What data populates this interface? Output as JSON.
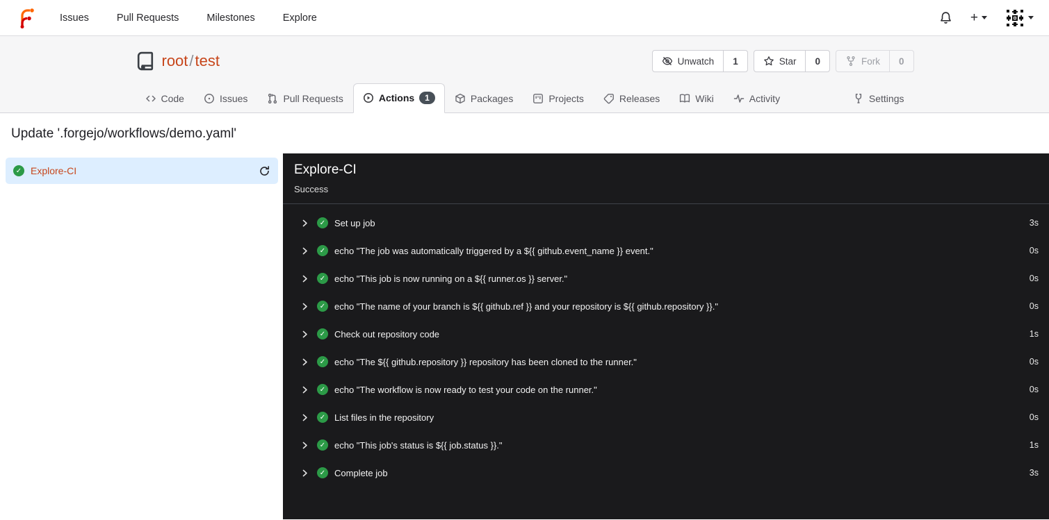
{
  "navbar": {
    "links": [
      {
        "label": "Issues"
      },
      {
        "label": "Pull Requests"
      },
      {
        "label": "Milestones"
      },
      {
        "label": "Explore"
      }
    ]
  },
  "repo_header": {
    "owner": "root",
    "separator": "/",
    "name": "test",
    "watch": {
      "label": "Unwatch",
      "count": "1"
    },
    "star": {
      "label": "Star",
      "count": "0"
    },
    "fork": {
      "label": "Fork",
      "count": "0"
    }
  },
  "tabs": [
    {
      "label": "Code"
    },
    {
      "label": "Issues"
    },
    {
      "label": "Pull Requests"
    },
    {
      "label": "Actions",
      "badge": "1",
      "active": true
    },
    {
      "label": "Packages"
    },
    {
      "label": "Projects"
    },
    {
      "label": "Releases"
    },
    {
      "label": "Wiki"
    },
    {
      "label": "Activity"
    },
    {
      "label": "Settings"
    }
  ],
  "page": {
    "title": "Update '.forgejo/workflows/demo.yaml'"
  },
  "sidebar": {
    "jobs": [
      {
        "name": "Explore-CI",
        "status": "success"
      }
    ]
  },
  "job_panel": {
    "title": "Explore-CI",
    "status_text": "Success",
    "steps": [
      {
        "name": "Set up job",
        "duration": "3s"
      },
      {
        "name": "echo \"The job was automatically triggered by a ${{ github.event_name }} event.\"",
        "duration": "0s"
      },
      {
        "name": "echo \"This job is now running on a ${{ runner.os }} server.\"",
        "duration": "0s"
      },
      {
        "name": "echo \"The name of your branch is ${{ github.ref }} and your repository is ${{ github.repository }}.\"",
        "duration": "0s"
      },
      {
        "name": "Check out repository code",
        "duration": "1s"
      },
      {
        "name": "echo \"The ${{ github.repository }} repository has been cloned to the runner.\"",
        "duration": "0s"
      },
      {
        "name": "echo \"The workflow is now ready to test your code on the runner.\"",
        "duration": "0s"
      },
      {
        "name": "List files in the repository",
        "duration": "0s"
      },
      {
        "name": "echo \"This job's status is ${{ job.status }}.\"",
        "duration": "1s"
      },
      {
        "name": "Complete job",
        "duration": "3s"
      }
    ]
  },
  "icons": {
    "check_glyph": "✓"
  },
  "colors": {
    "accent_link": "#c7461b",
    "success_green": "#2c9a47",
    "badge_bg": "#485058",
    "selected_job_bg": "#ddeeff",
    "panel_bg": "#1a1a1c",
    "header_bg": "#f6f6f7"
  }
}
